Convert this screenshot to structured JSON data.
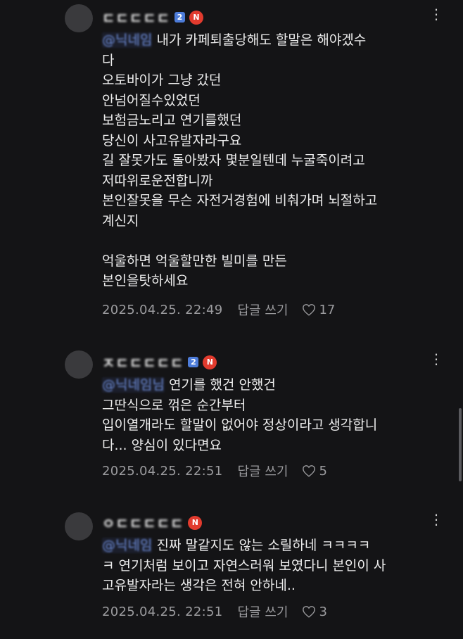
{
  "comments": [
    {
      "username": "ㄷㄷㄷㄷㄷ",
      "grade": "2",
      "new_badge": "N",
      "mention": "@닉네임",
      "body": " 내가 카페퇴출당해도 할말은 해야겠수\n다\n오토바이가 그냥 갔던\n안넘어질수있었던\n보험금노리고 연기를했던\n당신이 사고유발자라구요\n길 잘못가도 돌아봤자 몇분일텐데 누굴죽이려고\n저따위로운전합니까\n본인잘못을 무슨 자전거경험에 비춰가며 뇌절하고\n계신지\n\n억울하면 억울할만한 빌미를 만든\n본인을탓하세요",
      "date": "2025.04.25. 22:49",
      "reply": "답글 쓰기",
      "likes": "17"
    },
    {
      "username": "ㅈㄷㄷㄷㄷㄷ",
      "grade": "2",
      "new_badge": "N",
      "mention": "@닉네임님",
      "body": " 연기를 했건 안했건\n그딴식으로 꺾은 순간부터\n입이열개라도 할말이 없어야 정상이라고 생각합니\n다... 양심이 있다면요",
      "date": "2025.04.25. 22:51",
      "reply": "답글 쓰기",
      "likes": "5"
    },
    {
      "username": "ㅇㄷㄷㄷㄷㄷ",
      "grade": "",
      "new_badge": "N",
      "mention": "@닉네임",
      "body": " 진짜 말같지도 않는 소릴하네 ㅋㅋㅋㅋ\nㅋ 연기처럼 보이고 자연스러워 보였다니 본인이 사\n고유발자라는 생각은 전혀 안하네..",
      "date": "2025.04.25. 22:51",
      "reply": "답글 쓰기",
      "likes": "3"
    }
  ],
  "icons": {
    "more": "more-vertical-icon",
    "heart": "heart-outline-icon"
  },
  "colors": {
    "background": "#141416",
    "mention": "#6f8fdc",
    "new_badge": "#e23b2e",
    "grade_badge": "#4d7cd9"
  }
}
